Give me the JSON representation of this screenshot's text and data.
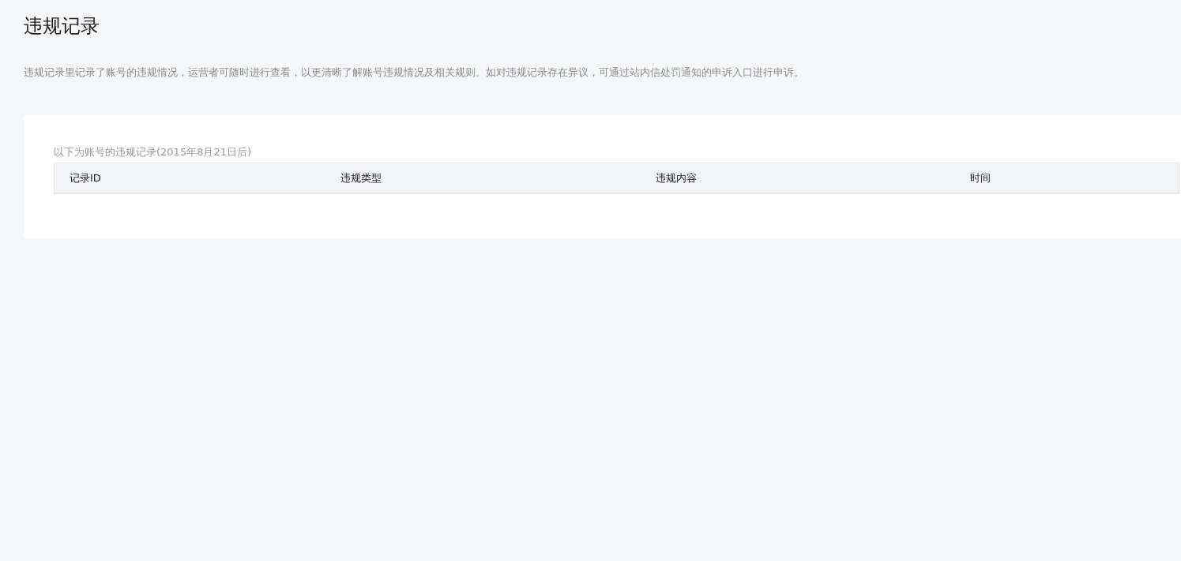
{
  "page": {
    "title": "违规记录",
    "description": "违规记录里记录了账号的违规情况，运营者可随时进行查看，以更清晰了解账号违规情况及相关规则。如对违规记录存在异议，可通过站内信处罚通知的申诉入口进行申诉。"
  },
  "records": {
    "caption": "以下为账号的违规记录(2015年8月21日后)",
    "table": {
      "columns": [
        "记录ID",
        "违规类型",
        "违规内容",
        "时间"
      ]
    }
  }
}
